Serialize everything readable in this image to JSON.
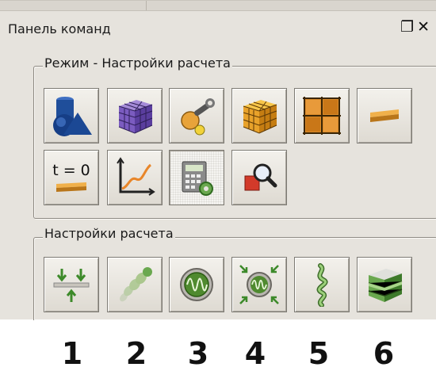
{
  "panel": {
    "title": "Панель команд",
    "restore_icon": "restore-window-icon",
    "close_icon": "close-icon"
  },
  "group1": {
    "title": "Режим - Настройки расчета",
    "buttons": [
      {
        "icon": "geometry-shapes-icon"
      },
      {
        "icon": "mesh-cube-purple-icon"
      },
      {
        "icon": "wrench-settings-icon"
      },
      {
        "icon": "mesh-cube-orange-icon"
      },
      {
        "icon": "grid-layout-icon"
      },
      {
        "icon": "beam-icon"
      },
      {
        "icon": "initial-conditions-icon",
        "label": "t = 0"
      },
      {
        "icon": "chart-curve-icon"
      },
      {
        "icon": "calculation-settings-icon"
      },
      {
        "icon": "zoom-result-icon"
      }
    ]
  },
  "group2": {
    "title": "Настройки расчета",
    "buttons": [
      {
        "icon": "supports-loads-icon"
      },
      {
        "icon": "beads-chain-icon"
      },
      {
        "icon": "wave-circle-icon"
      },
      {
        "icon": "wave-circle-arrows-icon"
      },
      {
        "icon": "spring-icon"
      },
      {
        "icon": "layered-cube-icon"
      }
    ]
  },
  "footer_numbers": [
    "1",
    "2",
    "3",
    "4",
    "5",
    "6"
  ],
  "colors": {
    "panel_bg": "#e6e3dd",
    "accent_orange": "#e8a33a",
    "accent_green": "#6aa84f",
    "accent_purple": "#6a4fa3",
    "accent_blue": "#1f4e9a"
  }
}
